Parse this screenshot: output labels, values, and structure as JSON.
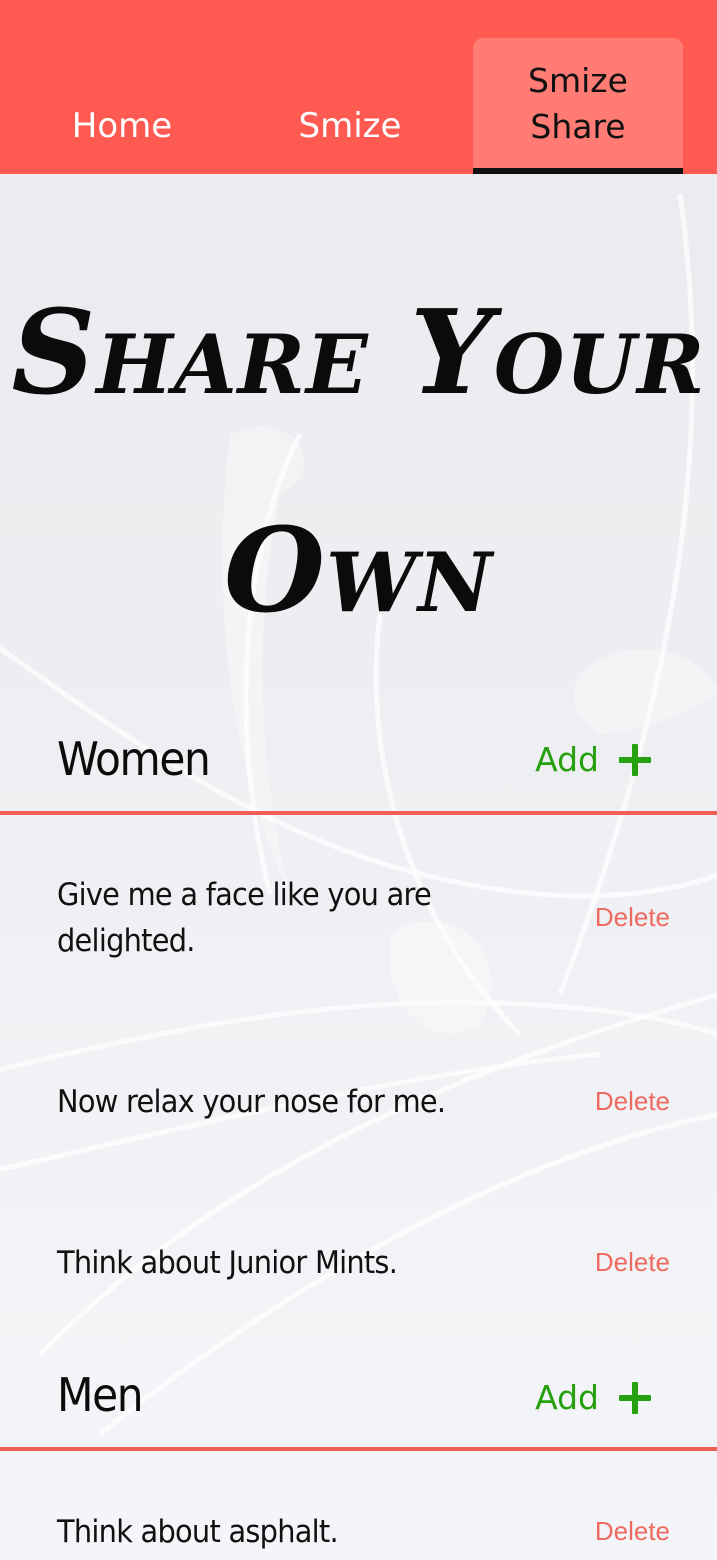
{
  "nav": {
    "tabs": [
      {
        "label": "Home"
      },
      {
        "label": "Smize"
      },
      {
        "label_line1": "Smize",
        "label_line2": "Share",
        "active": true
      }
    ]
  },
  "hero": {
    "title": "Share Your Own"
  },
  "sections": {
    "women": {
      "title": "Women",
      "add_label": "Add",
      "items": [
        {
          "text": "Give me a face like you are delighted.",
          "delete_label": "Delete"
        },
        {
          "text": "Now relax your nose for me.",
          "delete_label": "Delete"
        },
        {
          "text": "Think about Junior Mints.",
          "delete_label": "Delete"
        }
      ]
    },
    "men": {
      "title": "Men",
      "add_label": "Add",
      "items": [
        {
          "text": "Think about asphalt.",
          "delete_label": "Delete"
        }
      ]
    }
  },
  "colors": {
    "header_bg": "#fe5a52",
    "active_tab_bg": "#ff7b73",
    "divider": "#f06058",
    "add": "#26a00e",
    "delete": "#ef6a60"
  },
  "icons": {
    "add": "plus-icon"
  }
}
